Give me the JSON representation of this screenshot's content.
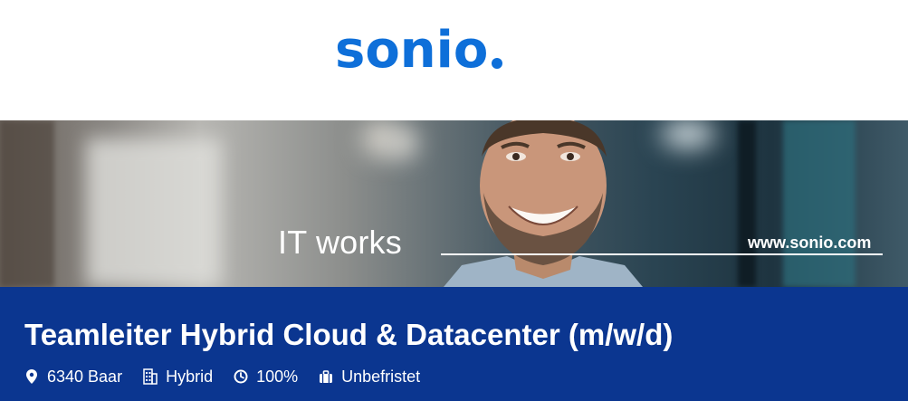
{
  "header": {
    "logo_text": "sonio"
  },
  "banner": {
    "tagline": "IT works",
    "website": "www.sonio.com"
  },
  "job": {
    "title": "Teamleiter Hybrid Cloud & Datacenter (m/w/d)",
    "meta": [
      {
        "icon": "location-pin-icon",
        "label": "6340 Baar"
      },
      {
        "icon": "building-icon",
        "label": "Hybrid"
      },
      {
        "icon": "clock-icon",
        "label": "100%"
      },
      {
        "icon": "briefcase-icon",
        "label": "Unbefristet"
      }
    ]
  },
  "colors": {
    "brand_blue": "#0e6fd9",
    "job_bar": "#0b3690",
    "text_on_dark": "#ffffff"
  }
}
